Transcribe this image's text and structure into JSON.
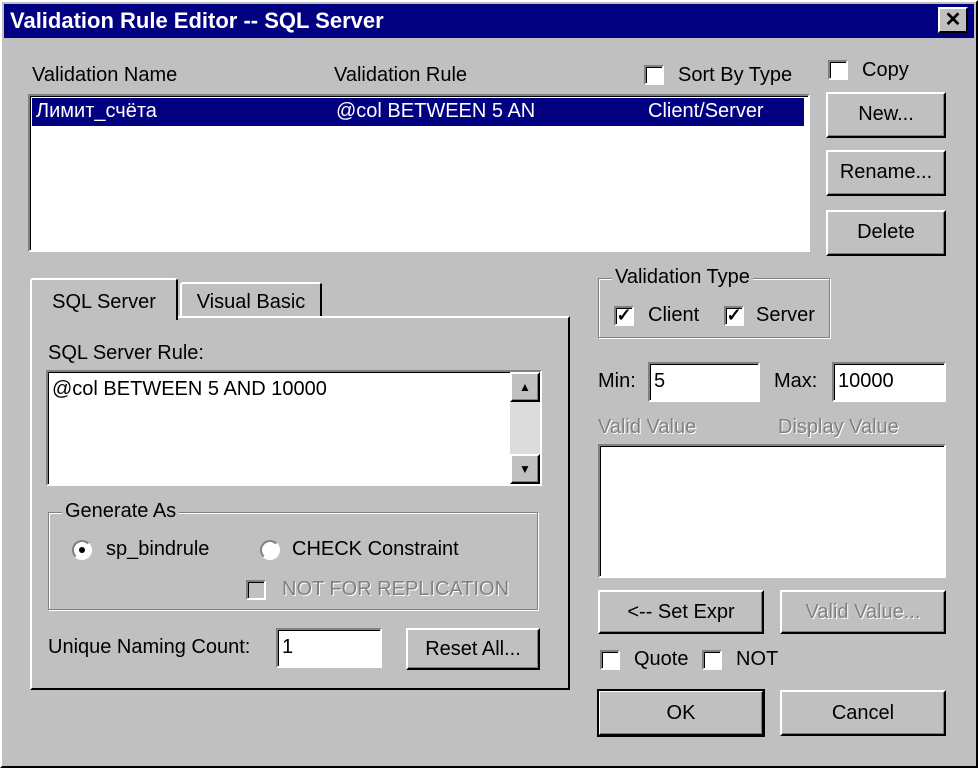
{
  "window": {
    "title": "Validation Rule Editor -- SQL Server",
    "close_glyph": "✕"
  },
  "list": {
    "headers": {
      "name": "Validation Name",
      "rule": "Validation Rule"
    },
    "sort_by_type_label": "Sort By Type",
    "rows": [
      {
        "name": "Лимит_счёта",
        "rule": "@col BETWEEN 5 AN",
        "type": "Client/Server",
        "selected": true
      }
    ]
  },
  "side_buttons": {
    "copy_label": "Copy",
    "new_label": "New...",
    "rename_label": "Rename...",
    "delete_label": "Delete"
  },
  "tabs": [
    {
      "label": "SQL Server",
      "active": true
    },
    {
      "label": "Visual Basic",
      "active": false
    }
  ],
  "sql_panel": {
    "rule_label": "SQL Server Rule:",
    "rule_value": "@col BETWEEN 5 AND 10000",
    "generate_as": {
      "title": "Generate As",
      "option1": "sp_bindrule",
      "option2": "CHECK Constraint",
      "selected": "sp_bindrule",
      "not_for_replication": "NOT FOR REPLICATION"
    },
    "unique_count_label": "Unique Naming Count:",
    "unique_count_value": "1",
    "reset_all_label": "Reset All..."
  },
  "validation_type": {
    "title": "Validation Type",
    "client_label": "Client",
    "server_label": "Server",
    "client_checked": true,
    "server_checked": true
  },
  "range": {
    "min_label": "Min:",
    "min_value": "5",
    "max_label": "Max:",
    "max_value": "10000"
  },
  "values": {
    "valid_value_header": "Valid Value",
    "display_value_header": "Display Value"
  },
  "expr_buttons": {
    "set_expr_label": "<-- Set Expr",
    "valid_value_label": "Valid Value..."
  },
  "options": {
    "quote_label": "Quote",
    "not_label": "NOT"
  },
  "footer": {
    "ok_label": "OK",
    "cancel_label": "Cancel"
  }
}
